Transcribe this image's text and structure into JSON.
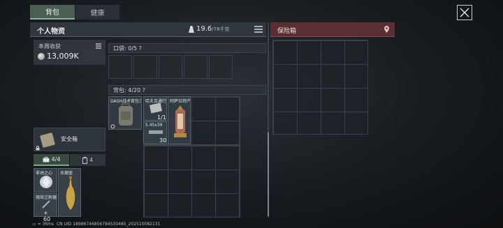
{
  "tabs": [
    {
      "label": "背包"
    },
    {
      "label": "健康"
    }
  ],
  "personal": {
    "title": "个人物资",
    "weight": "19.6",
    "weight_max": "/78千克"
  },
  "safe_box_panel": {
    "title": "保险箱"
  },
  "weekly": {
    "label": "本周收获",
    "value": "13,009K"
  },
  "pocket": {
    "label": "口袋: 0/5 ?"
  },
  "backpack": {
    "label": "背包: 4/20 ?"
  },
  "items": {
    "backpack_item": {
      "name": "DASH战术背包三型"
    },
    "card_item": {
      "name": "哈夫克通行证",
      "qty": "1/1"
    },
    "ammo_item": {
      "name": "5.45x39",
      "qty": "30"
    },
    "lantern_item": {
      "name": "阿萨拉特产灯"
    },
    "safe_item": {
      "label": "安全箱"
    },
    "heart_item": {
      "name": "非洲之心"
    },
    "injector_item": {
      "name": "强效注射器",
      "qty": "60"
    },
    "bottle_item": {
      "name": "水烟壶"
    }
  },
  "mini_tabs": {
    "first": "4/4",
    "second": "4"
  },
  "footer": {
    "ping": "36ms",
    "uid": "CN UID 18986746856784530485_202510082131"
  },
  "colors": {
    "accent": "#8fb39a",
    "safe_header": "#5a2f33"
  }
}
